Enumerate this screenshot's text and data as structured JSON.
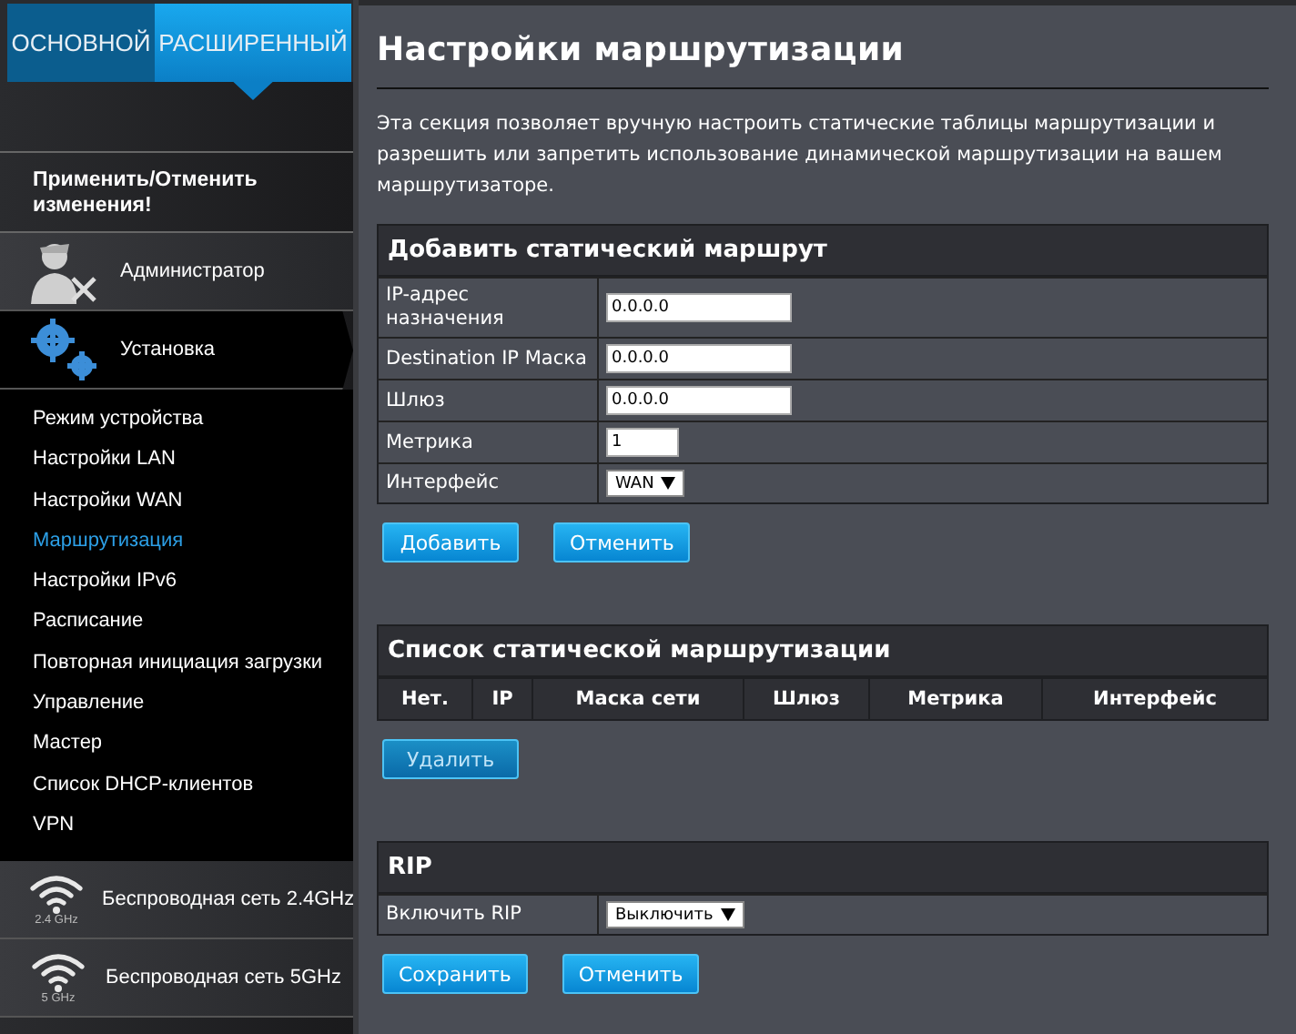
{
  "tabs": [
    {
      "label": "ОСНОВНОЙ",
      "selected": false
    },
    {
      "label": "РАСШИРЕННЫЙ",
      "selected": true
    }
  ],
  "sidebar": {
    "apply_label": "Применить/Отменить изменения!",
    "groups": [
      {
        "label": "Администратор",
        "kind": "admin",
        "expanded": false
      },
      {
        "label": "Установка",
        "kind": "gears",
        "expanded": true,
        "children": [
          {
            "label": "Режим устройства",
            "selected": false
          },
          {
            "label": "Настройки LAN",
            "selected": false
          },
          {
            "label": "Настройки WAN",
            "selected": false
          },
          {
            "label": "Маршрутизация",
            "selected": true
          },
          {
            "label": "Настройки IPv6",
            "selected": false
          },
          {
            "label": "Расписание",
            "selected": false
          },
          {
            "label": "Повторная инициация загрузки",
            "selected": false
          },
          {
            "label": "Управление",
            "selected": false
          },
          {
            "label": "Мастер",
            "selected": false
          },
          {
            "label": "Список DHCP-клиентов",
            "selected": false
          },
          {
            "label": "VPN",
            "selected": false
          }
        ]
      },
      {
        "label": "Беспроводная сеть 2.4GHz",
        "kind": "wifi",
        "badge": "2.4 GHz",
        "expanded": false
      },
      {
        "label": "Беспроводная сеть 5GHz",
        "kind": "wifi",
        "badge": "5 GHz",
        "expanded": false
      }
    ]
  },
  "page": {
    "title": "Настройки маршрутизации",
    "description": "Эта секция позволяет вручную настроить статические таблицы маршрутизации и разрешить или запретить использование динамической маршрутизации на вашем маршрутизаторе.",
    "sections": [
      {
        "title": "Добавить статический маршрут",
        "kind": "form",
        "rows": [
          {
            "label": "IP-адрес назначения",
            "kind": "text",
            "value": "0.0.0.0"
          },
          {
            "label": "Destination IP Маска",
            "kind": "text",
            "value": "0.0.0.0"
          },
          {
            "label": "Шлюз",
            "kind": "text",
            "value": "0.0.0.0"
          },
          {
            "label": "Метрика",
            "kind": "short",
            "value": "1"
          },
          {
            "label": "Интерфейс",
            "kind": "select",
            "value": "WAN"
          }
        ],
        "buttons": [
          {
            "label": "Добавить",
            "disabled": false
          },
          {
            "label": "Отменить",
            "disabled": false
          }
        ]
      },
      {
        "title": "Список статической маршрутизации",
        "kind": "table",
        "columns": [
          "Нет.",
          "IP",
          "Маска сети",
          "Шлюз",
          "Метрика",
          "Интерфейс"
        ],
        "buttons": [
          {
            "label": "Удалить",
            "disabled": true
          }
        ]
      },
      {
        "title": "RIP",
        "kind": "form",
        "rows": [
          {
            "label": "Включить RIP",
            "kind": "select",
            "value": "Выключить"
          }
        ],
        "buttons": [
          {
            "label": "Сохранить",
            "disabled": false
          },
          {
            "label": "Отменить",
            "disabled": false
          }
        ]
      }
    ]
  }
}
